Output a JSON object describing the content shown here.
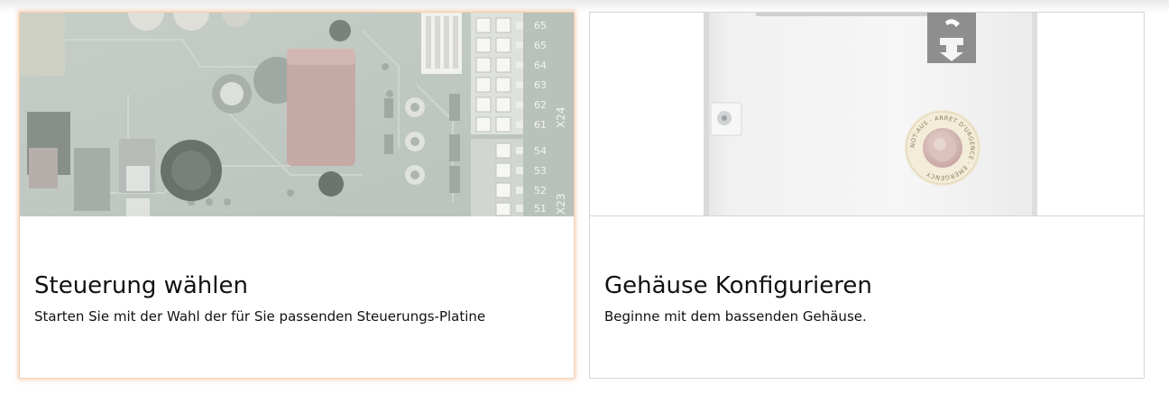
{
  "cards": [
    {
      "title": "Steuerung wählen",
      "description": "Starten Sie mit der Wahl der für Sie passenden Steuerungs-Platine",
      "image": {
        "subject": "controller-board-photo",
        "terminal_labels_top": [
          "65",
          "65",
          "64",
          "63",
          "62",
          "61"
        ],
        "terminal_labels_bottom": [
          "54",
          "53",
          "52",
          "51"
        ],
        "connector_labels": [
          "X24",
          "X23"
        ]
      }
    },
    {
      "title": "Gehäuse Konfigurieren",
      "description": "Beginne mit dem bassenden Gehäuse.",
      "image": {
        "subject": "enclosure-photo",
        "estop_ring_text": "NOT-AUS · ARRET D'URGENCE · EMERGENCY"
      }
    }
  ],
  "colors": {
    "selected_border": "#f2cfb3",
    "selected_glow": "#eca26e",
    "card_border": "#d6d6d6"
  }
}
